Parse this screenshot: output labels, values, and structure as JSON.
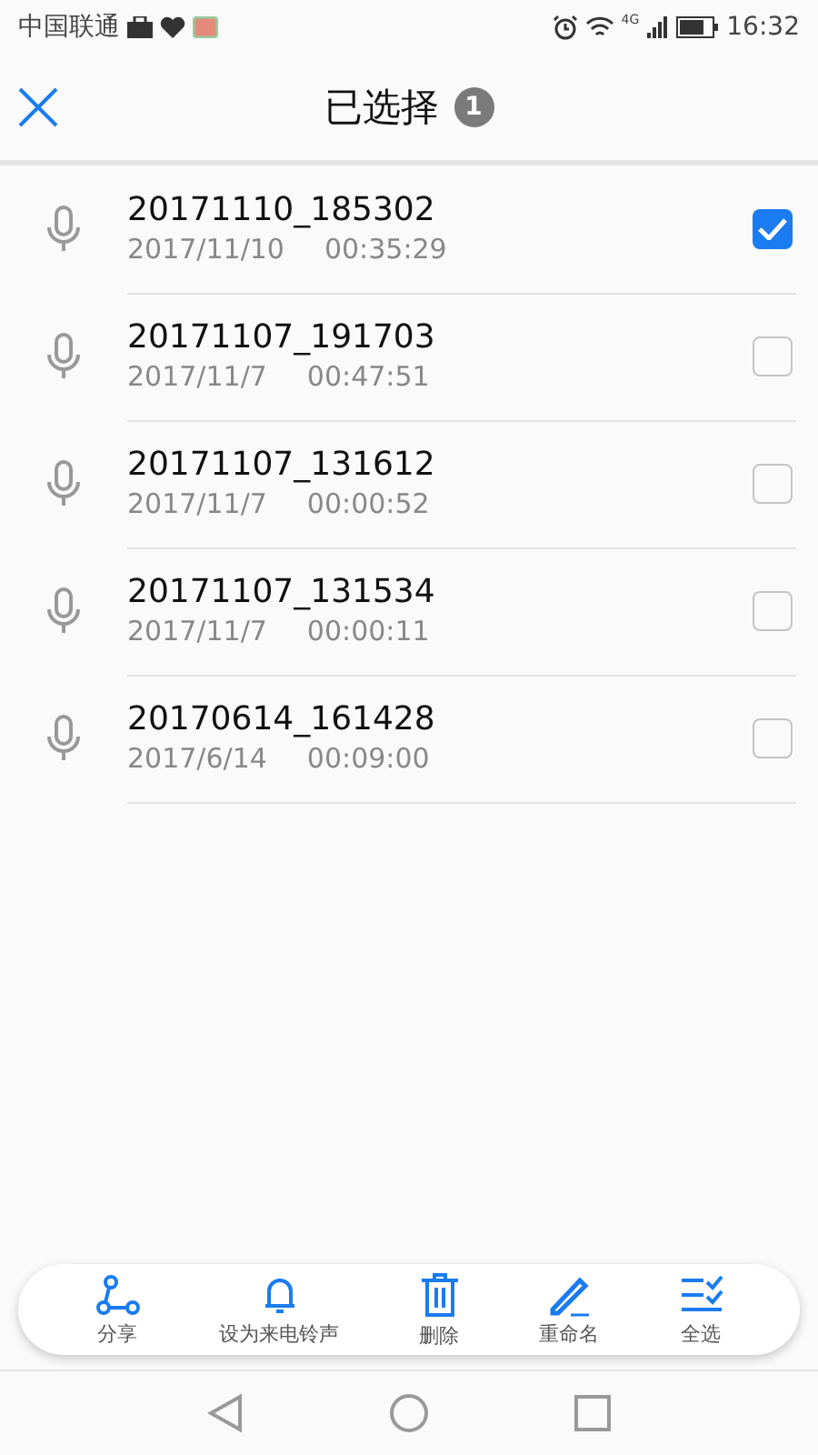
{
  "status_bar": {
    "carrier": "中国联通",
    "time": "16:32",
    "network": "4G"
  },
  "header": {
    "title": "已选择",
    "count": "1"
  },
  "recordings": [
    {
      "name": "20171110_185302",
      "date": "2017/11/10",
      "duration": "00:35:29",
      "checked": true
    },
    {
      "name": "20171107_191703",
      "date": "2017/11/7",
      "duration": "00:47:51",
      "checked": false
    },
    {
      "name": "20171107_131612",
      "date": "2017/11/7",
      "duration": "00:00:52",
      "checked": false
    },
    {
      "name": "20171107_131534",
      "date": "2017/11/7",
      "duration": "00:00:11",
      "checked": false
    },
    {
      "name": "20170614_161428",
      "date": "2017/6/14",
      "duration": "00:09:00",
      "checked": false
    }
  ],
  "actions": [
    {
      "kind": "share",
      "label": "分享"
    },
    {
      "kind": "ringtone",
      "label": "设为来电铃声"
    },
    {
      "kind": "delete",
      "label": "删除"
    },
    {
      "kind": "rename",
      "label": "重命名"
    },
    {
      "kind": "selectall",
      "label": "全选"
    }
  ]
}
